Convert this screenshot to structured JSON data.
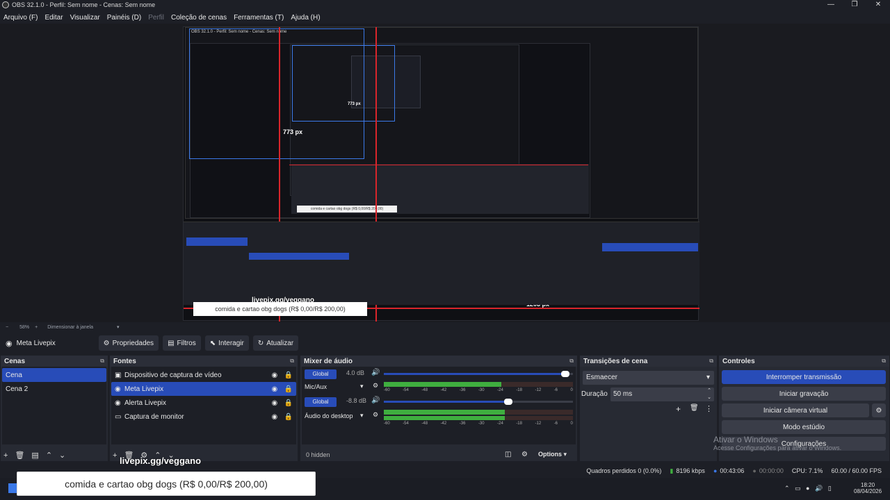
{
  "window": {
    "title": "OBS 32.1.0 - Perfil: Sem nome - Cenas: Sem nome",
    "controls": [
      "—",
      "❐",
      "✕"
    ]
  },
  "menu": [
    {
      "label": "Arquivo (F)",
      "enabled": true
    },
    {
      "label": "Editar",
      "enabled": true
    },
    {
      "label": "Visualizar",
      "enabled": true
    },
    {
      "label": "Painéis (D)",
      "enabled": true
    },
    {
      "label": "Perfil",
      "enabled": false
    },
    {
      "label": "Coleção de cenas",
      "enabled": true
    },
    {
      "label": "Ferramentas (T)",
      "enabled": true
    },
    {
      "label": "Ajuda (H)",
      "enabled": true
    }
  ],
  "preview": {
    "zoom": "58%",
    "zoom_mode": "Dimensionar à janela",
    "nested_title": "OBS 32.1.0 - Perfil: Sem nome - Cenas: Sem nome",
    "measure_a": "773 px",
    "measure_b": "773 px",
    "measure_c": "1203 px",
    "overlay_label": "livepix.gg/veggano",
    "overlay_text": "comida e cartao obg dogs (R$ 0,00/R$ 200,00)"
  },
  "source_toolbar": {
    "selected_source": "Meta Livepix",
    "properties": "Propriedades",
    "filters": "Filtros",
    "interact": "Interagir",
    "refresh": "Atualizar"
  },
  "scenes": {
    "title": "Cenas",
    "items": [
      "Cena",
      "Cena 2"
    ],
    "selected": 0
  },
  "sources": {
    "title": "Fontes",
    "items": [
      {
        "name": "Dispositivo de captura de vídeo",
        "icon": "camera-icon"
      },
      {
        "name": "Meta Livepix",
        "icon": "globe-icon"
      },
      {
        "name": "Alerta Livepix",
        "icon": "globe-icon"
      },
      {
        "name": "Captura de monitor",
        "icon": "monitor-icon"
      }
    ],
    "selected": 1
  },
  "mixer": {
    "title": "Mixer de áudio",
    "channels": [
      {
        "name": "Mic/Aux",
        "db": "4.0 dB",
        "global": "Global",
        "volume": 0.98,
        "level": 0.62
      },
      {
        "name": "Áudio do desktop",
        "db": "-8.8 dB",
        "global": "Global",
        "volume": 0.68,
        "level": 0.64
      }
    ],
    "ticks": [
      "-60",
      "-54",
      "-48",
      "-42",
      "-36",
      "-30",
      "-24",
      "-18",
      "-12",
      "-6",
      "0"
    ],
    "hidden": "0 hidden",
    "options": "Options"
  },
  "transitions": {
    "title": "Transições de cena",
    "type": "Esmaecer",
    "duration_label": "Duração",
    "duration": "50 ms"
  },
  "controls": {
    "title": "Controles",
    "stop_stream": "Interromper transmissão",
    "start_record": "Iniciar gravação",
    "start_vcam": "Iniciar câmera virtual",
    "studio": "Modo estúdio",
    "settings": "Configurações"
  },
  "status": {
    "dropped": "Quadros perdidos 0 (0.0%)",
    "bitrate": "8196 kbps",
    "live": "00:43:06",
    "rec": "00:00:00",
    "cpu": "CPU: 7.1%",
    "fps": "60.00 / 60.00 FPS"
  },
  "watermark": {
    "line1": "Ativar o Windows",
    "line2": "Acesse Configurações para ativar o Windows."
  },
  "taskbar": {
    "time": "18:20",
    "date": "08/04/2026"
  },
  "colors": {
    "accent": "#284cb8",
    "measure": "#d9252b",
    "guide": "#3b79e8"
  }
}
